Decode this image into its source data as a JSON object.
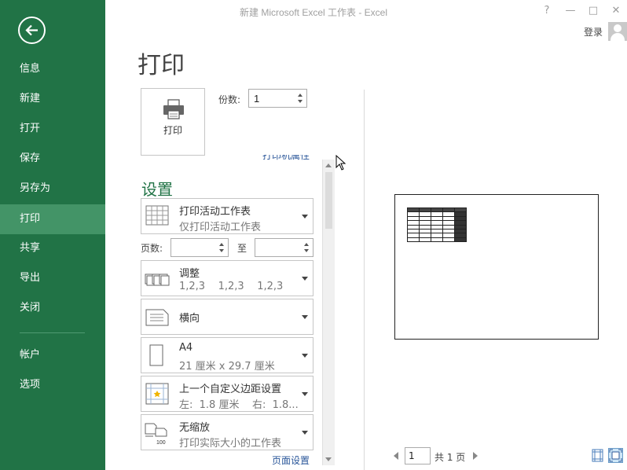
{
  "window": {
    "title": "新建 Microsoft Excel 工作表 - Excel",
    "help": "?",
    "minimize": "—",
    "restore": "□",
    "close": "✕",
    "signin": "登录"
  },
  "sidebar": {
    "items": [
      {
        "label": "信息"
      },
      {
        "label": "新建"
      },
      {
        "label": "打开"
      },
      {
        "label": "保存"
      },
      {
        "label": "另存为"
      },
      {
        "label": "打印"
      },
      {
        "label": "共享"
      },
      {
        "label": "导出"
      },
      {
        "label": "关闭"
      },
      {
        "label": "帐户"
      },
      {
        "label": "选项"
      }
    ],
    "active": "打印"
  },
  "print": {
    "title": "打印",
    "button_label": "打印",
    "copies_label": "份数:",
    "copies_value": "1",
    "printer_properties": "打印机属性"
  },
  "settings": {
    "heading": "设置",
    "what_to_print": {
      "line1": "打印活动工作表",
      "line2": "仅打印活动工作表"
    },
    "pages_label": "页数:",
    "pages_to_label": "至",
    "pages_from": "",
    "pages_to": "",
    "collation": {
      "line1": "调整",
      "line2": "1,2,3    1,2,3    1,2,3"
    },
    "orientation": {
      "line1": "横向"
    },
    "paper": {
      "line1": "A4",
      "line2": "21 厘米 x 29.7 厘米"
    },
    "margins": {
      "line1": "上一个自定义边距设置",
      "line2": "左:  1.8 厘米    右:  1.8..."
    },
    "scaling": {
      "line1": "无缩放",
      "line2": "打印实际大小的工作表"
    },
    "page_setup_link": "页面设置"
  },
  "preview": {
    "current_page": "1",
    "total_pages": "共 1 页"
  },
  "colors": {
    "sidebar": "#217346",
    "sidebar_active": "#439467",
    "link": "#2b579a"
  }
}
